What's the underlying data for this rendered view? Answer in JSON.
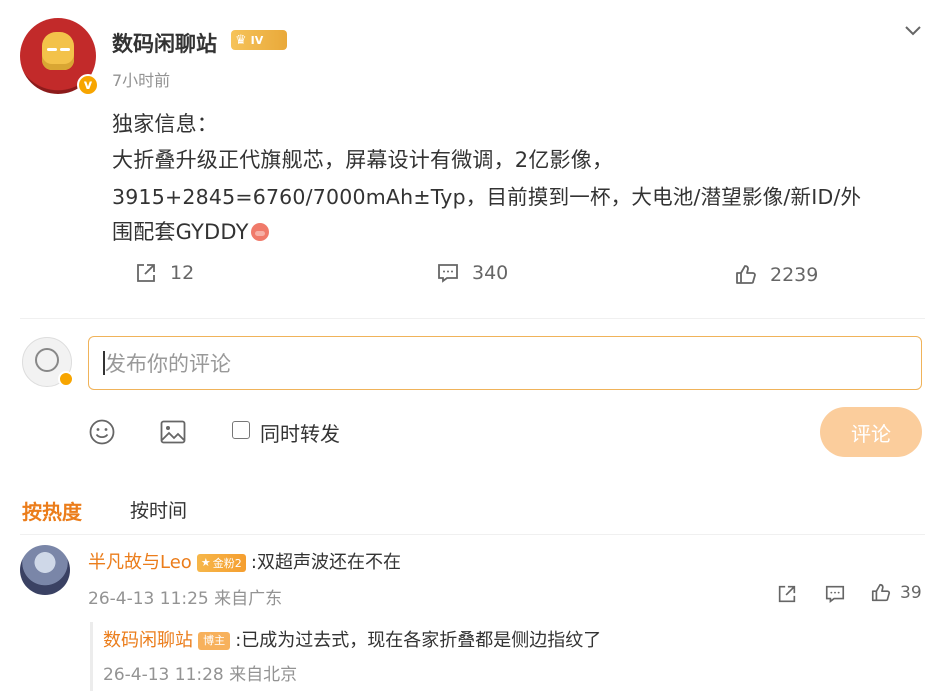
{
  "post": {
    "author": "数码闲聊站",
    "level": "IV",
    "time": "7小时前",
    "lines": [
      "独家信息：",
      "大折叠升级正代旗舰芯，屏幕设计有微调，2亿影像，",
      "3915+2845=6760/7000mAh±Typ，目前摸到一杯，大电池/潜望影像/新ID/外",
      "围配套GYDDY"
    ],
    "reposts": "12",
    "comments": "340",
    "likes": "2239"
  },
  "composer": {
    "placeholder": "发布你的评论",
    "repost_label": "同时转发",
    "submit_label": "评论"
  },
  "sort_tabs": {
    "hot": "按热度",
    "time": "按时间"
  },
  "comments": [
    {
      "user": "半凡故与Leo",
      "badge": "金粉2",
      "text": ":双超声波还在不在",
      "meta": "26-4-13 11:25 来自广东",
      "likes": "39",
      "reply": {
        "user": "数码闲聊站",
        "badge": "博主",
        "text": ":已成为过去式，现在各家折叠都是侧边指纹了",
        "meta": "26-4-13 11:28 来自北京"
      }
    }
  ],
  "colors": {
    "accent": "#eb7d1b",
    "submit_bg": "#fbcd9c",
    "input_border": "#f0b35a"
  }
}
